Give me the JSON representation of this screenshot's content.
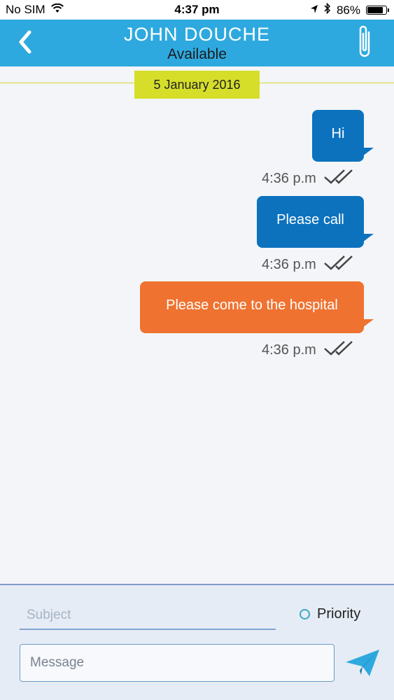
{
  "status_bar": {
    "carrier": "No SIM",
    "time": "4:37 pm",
    "battery": "86%",
    "battery_level": 0.86
  },
  "header": {
    "title": "JOHN DOUCHE",
    "subtitle": "Available"
  },
  "date_divider": "5 January 2016",
  "messages": [
    {
      "text": "Hi",
      "time": "4:36 p.m",
      "color": "#0c72be"
    },
    {
      "text": "Please call",
      "time": "4:36 p.m",
      "color": "#0c72be"
    },
    {
      "text": "Please come to the hospital",
      "time": "4:36 p.m",
      "color": "#ef7230"
    }
  ],
  "composer": {
    "subject_placeholder": "Subject",
    "priority_label": "Priority",
    "message_placeholder": "Message"
  },
  "colors": {
    "header": "#2ea9df",
    "accent_yellow": "#d6de2a",
    "bubble_blue": "#0c72be",
    "bubble_orange": "#ef7230"
  }
}
